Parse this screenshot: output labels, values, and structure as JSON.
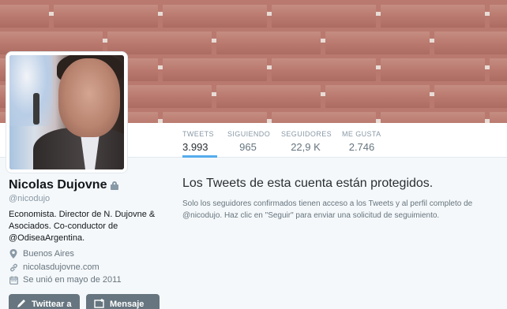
{
  "profile": {
    "name": "Nicolas Dujovne",
    "handle": "@nicodujo",
    "bio": "Economista. Director de N. Dujovne & Asociados. Co-conductor de @OdiseaArgentina.",
    "location": "Buenos Aires",
    "website": "nicolasdujovne.com",
    "joined": "Se unió en mayo de 2011"
  },
  "stats": [
    {
      "label": "TWEETS",
      "value": "3.993"
    },
    {
      "label": "SIGUIENDO",
      "value": "965"
    },
    {
      "label": "SEGUIDORES",
      "value": "22,9 K"
    },
    {
      "label": "ME GUSTA",
      "value": "2.746"
    }
  ],
  "protected": {
    "title": "Los Tweets de esta cuenta están protegidos.",
    "text": "Solo los seguidores confirmados tienen acceso a los Tweets y al perfil completo de @nicodujo. Haz clic en \"Seguir\" para enviar una solicitud de seguimiento."
  },
  "buttons": {
    "tweet_to": "Twittear a",
    "message": "Mensaje"
  },
  "icons": {
    "lock": "lock-icon",
    "location": "location-pin-icon",
    "link": "link-icon",
    "calendar": "calendar-icon"
  },
  "colors": {
    "accent": "#55acee",
    "button": "#66757f"
  }
}
